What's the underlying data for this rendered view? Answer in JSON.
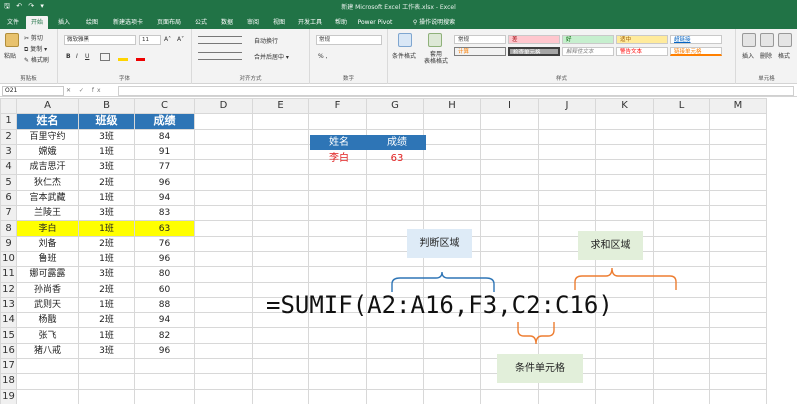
{
  "window": {
    "title": "新建 Microsoft Excel 工作表.xlsx - Excel",
    "quick_access": "🖫 ↶ ↷ ▾"
  },
  "tabs": [
    "文件",
    "开始",
    "插入",
    "绘图",
    "新建选项卡",
    "页面布局",
    "公式",
    "数据",
    "审阅",
    "视图",
    "开发工具",
    "帮助",
    "Power Pivot",
    "操作说明搜索"
  ],
  "active_tab": "开始",
  "ribbon": {
    "clipboard": {
      "paste": "粘贴",
      "cut": "✂ 剪切",
      "copy": "⧉ 复制 ▾",
      "painter": "✎ 格式刷",
      "label": "剪贴板"
    },
    "font": {
      "name": "微软雅黑",
      "size": "11",
      "grow": "A˄",
      "shrink": "A˅",
      "bold": "B",
      "italic": "I",
      "underline": "U",
      "label": "字体"
    },
    "alignment": {
      "wrap": "自动换行",
      "merge": "合并后居中 ▾",
      "label": "对齐方式"
    },
    "number": {
      "format": "常规",
      "percent": "% ,",
      "label": "数字"
    },
    "styles": {
      "cond": "条件格式",
      "table": "套用\n表格格式",
      "cells": [
        "常规",
        "差",
        "好",
        "适中",
        "超链接",
        "计算",
        "检查单元格",
        "解释性文本",
        "警告文本",
        "链接单元格"
      ],
      "label": "样式"
    },
    "cellgroup": {
      "insert": "插入",
      "delete": "删除",
      "format": "格式",
      "label": "单元格"
    }
  },
  "formula_bar": {
    "name_box": "O21",
    "fx": "✕ ✓ fx",
    "value": ""
  },
  "columns": [
    "A",
    "B",
    "C",
    "D",
    "E",
    "F",
    "G",
    "H",
    "I",
    "J",
    "K",
    "L",
    "M"
  ],
  "rows": [
    [
      "姓名",
      "班级",
      "成绩"
    ],
    [
      "百里守约",
      "3班",
      "84"
    ],
    [
      "嫦娥",
      "1班",
      "91"
    ],
    [
      "成吉思汗",
      "3班",
      "77"
    ],
    [
      "狄仁杰",
      "2班",
      "96"
    ],
    [
      "宫本武藏",
      "1班",
      "94"
    ],
    [
      "兰陵王",
      "3班",
      "83"
    ],
    [
      "李白",
      "1班",
      "63"
    ],
    [
      "刘备",
      "2班",
      "76"
    ],
    [
      "鲁班",
      "1班",
      "96"
    ],
    [
      "娜可露露",
      "3班",
      "80"
    ],
    [
      "孙尚香",
      "2班",
      "60"
    ],
    [
      "武则天",
      "1班",
      "88"
    ],
    [
      "杨戬",
      "2班",
      "94"
    ],
    [
      "张飞",
      "1班",
      "82"
    ],
    [
      "猪八戒",
      "3班",
      "96"
    ],
    [
      "",
      "",
      ""
    ],
    [
      "",
      "",
      ""
    ],
    [
      "",
      "",
      ""
    ]
  ],
  "highlight_row": 8,
  "lookup": {
    "header_name": "姓名",
    "header_score": "成绩",
    "name": "李白",
    "score": "63"
  },
  "formula": "=SUMIF(A2:A16,F3,C2:C16)",
  "callouts": {
    "range": "判断区域",
    "sum_range": "求和区域",
    "criteria": "条件单元格"
  },
  "colors": {
    "excel_green": "#217346",
    "header_blue": "#2e75b6",
    "highlight": "#ffff00",
    "brace_blue": "#2e75b6",
    "brace_orange": "#ed7d31",
    "red_text": "#e02020"
  }
}
